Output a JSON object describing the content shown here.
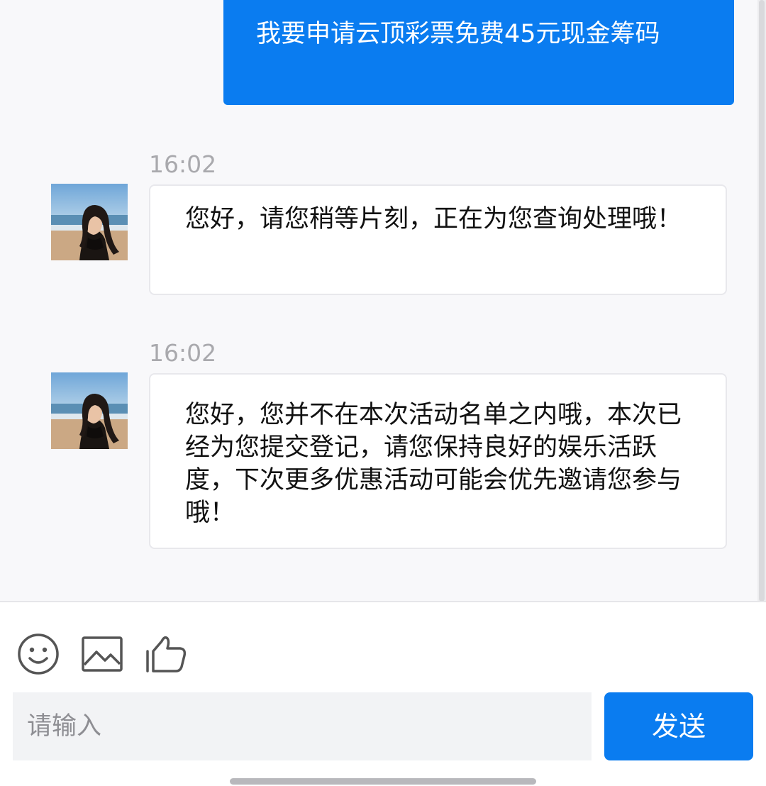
{
  "messages": [
    {
      "direction": "outgoing",
      "text": "我要申请云顶彩票免费45元现金筹码"
    },
    {
      "direction": "incoming",
      "time": "16:02",
      "text": "您好，请您稍等片刻，正在为您查询处理哦！"
    },
    {
      "direction": "incoming",
      "time": "16:02",
      "text": "您好，您并不在本次活动名单之内哦，本次已经为您提交登记，请您保持良好的娱乐活跃度，下次更多优惠活动可能会优先邀请您参与哦！"
    }
  ],
  "toolbar": {
    "icons": [
      "emoji-icon",
      "image-icon",
      "thumbs-up-icon"
    ]
  },
  "composer": {
    "placeholder": "请输入",
    "send_label": "发送"
  },
  "colors": {
    "accent": "#0a7cf0",
    "chat_background": "#f8f8fa",
    "timestamp": "#a9a9ad",
    "input_background": "#f2f3f5"
  }
}
